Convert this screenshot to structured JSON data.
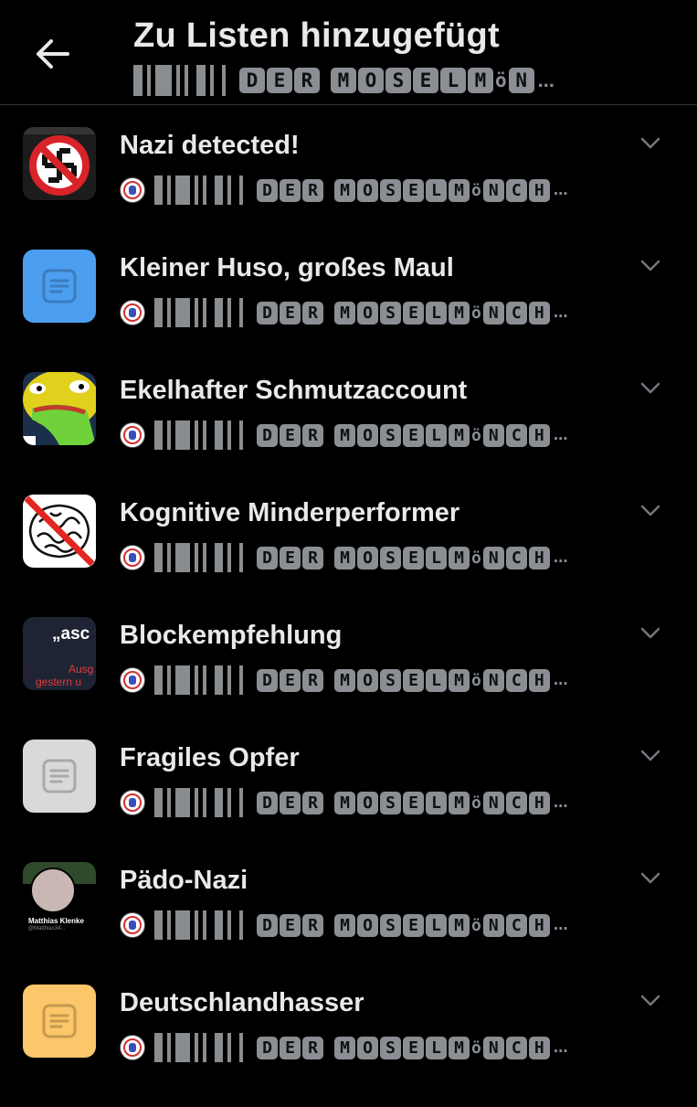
{
  "header": {
    "title": "Zu Listen hinzugefügt",
    "owner_letters": [
      "D",
      "E",
      "R",
      "M",
      "O",
      "S",
      "E",
      "L",
      "M",
      "ö",
      "N"
    ],
    "ellipsis": "..."
  },
  "owner_row": {
    "letters": [
      "D",
      "E",
      "R",
      "M",
      "O",
      "S",
      "E",
      "L",
      "M",
      "ö",
      "N",
      "C",
      "H"
    ],
    "ellipsis": "..."
  },
  "lists": [
    {
      "title": "Nazi detected!",
      "thumb": "anti-swastika-icon"
    },
    {
      "title": "Kleiner Huso, großes Maul",
      "thumb": "list-icon",
      "color": "#4c9ff0"
    },
    {
      "title": "Ekelhafter Schmutzaccount",
      "thumb": "disgusted-face-image"
    },
    {
      "title": "Kognitive Minderperformer",
      "thumb": "crossed-brain-image"
    },
    {
      "title": "Blockempfehlung",
      "thumb": "screenshot-image",
      "thumb_text_1": "„asc",
      "thumb_text_2": "Ausg",
      "thumb_text_3": "gestern u"
    },
    {
      "title": "Fragiles Opfer",
      "thumb": "list-icon",
      "color": "#d9d9d9"
    },
    {
      "title": "Pädo-Nazi",
      "thumb": "profile-screenshot-image",
      "thumb_name": "Matthias Klenke",
      "thumb_handle": "@Matthias34..."
    },
    {
      "title": "Deutschlandhasser",
      "thumb": "list-icon",
      "color": "#fcc66a"
    }
  ]
}
